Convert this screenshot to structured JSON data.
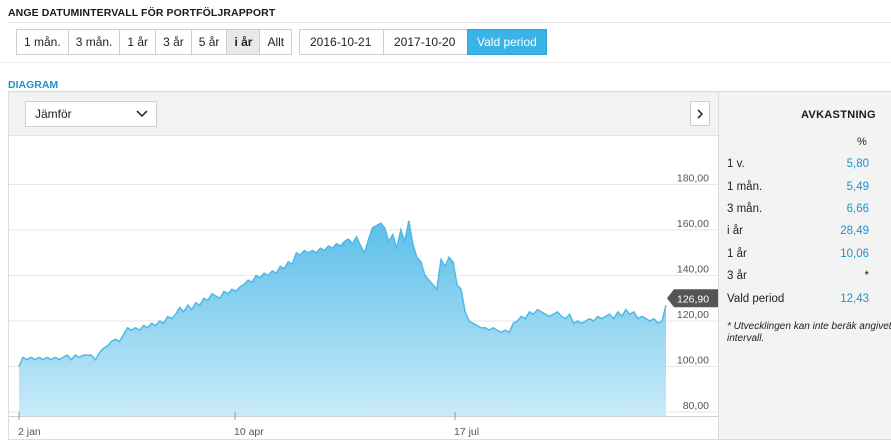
{
  "section": {
    "title": "ANGE DATUMINTERVALL FÖR PORTFÖLJRAPPORT"
  },
  "ranges": [
    {
      "label": "1 mån."
    },
    {
      "label": "3 mån."
    },
    {
      "label": "1 år"
    },
    {
      "label": "3 år"
    },
    {
      "label": "5 år"
    },
    {
      "label": "i år"
    },
    {
      "label": "Allt"
    }
  ],
  "active_range": "i år",
  "dates": {
    "from": "2016-10-21",
    "to": "2017-10-20"
  },
  "period_button": "Vald period",
  "diagram": {
    "title": "DIAGRAM",
    "compare_label": "Jämför",
    "current_value_label": "126,90"
  },
  "chart_data": {
    "type": "area",
    "x_ticks": [
      "2 jan",
      "10 apr",
      "17 jul"
    ],
    "y_ticks": [
      "80,00",
      "100,00",
      "120,00",
      "140,00",
      "160,00",
      "180,00"
    ],
    "ylim": [
      80,
      200
    ],
    "grid": true,
    "series": [
      {
        "values": [
          100,
          104,
          103,
          104,
          103,
          104,
          103,
          104,
          103,
          104,
          103,
          104,
          105,
          103,
          105,
          104,
          105,
          105,
          105,
          103,
          106,
          108,
          109,
          111,
          112,
          111,
          114,
          117,
          116,
          117,
          116,
          118,
          117,
          119,
          118,
          120,
          119,
          122,
          121,
          123,
          126,
          124,
          127,
          125,
          128,
          127,
          130,
          129,
          132,
          131,
          130,
          133,
          132,
          134,
          133,
          135,
          136,
          138,
          137,
          140,
          139,
          141,
          140,
          142,
          141,
          144,
          143,
          146,
          145,
          150,
          149,
          151,
          150,
          151,
          150,
          152,
          151,
          153,
          152,
          154,
          153,
          155,
          156,
          154,
          157,
          153,
          150,
          156,
          161,
          162,
          163,
          161,
          155,
          158,
          152,
          160,
          155,
          164,
          154,
          148,
          146,
          140,
          138,
          136,
          134,
          147,
          144,
          148,
          146,
          136,
          134,
          124,
          120,
          119,
          118,
          117,
          117,
          116,
          117,
          116,
          115,
          116,
          115,
          119,
          120,
          122,
          121,
          124,
          123,
          125,
          124,
          123,
          122,
          123,
          124,
          122,
          121,
          123,
          119,
          120,
          119,
          120,
          121,
          120,
          122,
          121,
          122,
          123,
          121,
          124,
          122,
          125,
          123,
          124,
          121,
          122,
          121,
          120,
          121,
          119,
          120,
          126.9
        ],
        "color": "#4fb9e6"
      }
    ]
  },
  "returns": {
    "title": "AVKASTNING",
    "unit": "%",
    "rows": [
      {
        "label": "1 v.",
        "value": "5,80"
      },
      {
        "label": "1 mån.",
        "value": "5,49"
      },
      {
        "label": "3 mån.",
        "value": "6,66"
      },
      {
        "label": "i år",
        "value": "28,49"
      },
      {
        "label": "1 år",
        "value": "10,06"
      },
      {
        "label": "3 år",
        "value": "*"
      },
      {
        "label": "Vald period",
        "value": "12,43"
      }
    ],
    "footnote": "* Utvecklingen kan inte beräk angivet intervall."
  },
  "colors": {
    "accent": "#3ab4e6",
    "link": "#1f93c9",
    "area_top": "#5bbfe9",
    "area_bottom": "#c8eaf8",
    "label_bg": "#555555"
  }
}
